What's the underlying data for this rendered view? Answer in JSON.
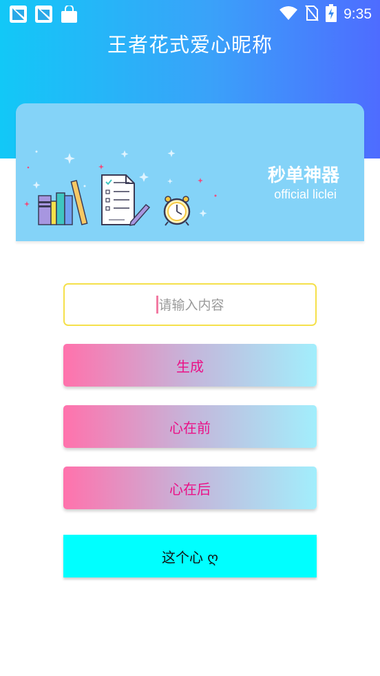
{
  "status_bar": {
    "time": "9:35"
  },
  "app": {
    "title": "王者花式爱心昵称"
  },
  "banner": {
    "title": "秒单神器",
    "subtitle": "official liclei"
  },
  "input": {
    "placeholder": "请输入内容",
    "value": ""
  },
  "buttons": {
    "generate": "生成",
    "heart_front": "心在前",
    "heart_back": "心在后",
    "this_heart": "这个心 ღ"
  },
  "colors": {
    "header_gradient": [
      "#12c8f7",
      "#4e6cff"
    ],
    "banner_bg": "#84d3f8",
    "button_text": "#ea1187",
    "cyan_button": "#00ffff",
    "input_border": "#f5e04a"
  },
  "icons": [
    "picture-notification-icon",
    "picture-notification-icon",
    "shopping-bag-icon",
    "wifi-icon",
    "no-sim-icon",
    "battery-charging-icon",
    "books-icon",
    "checklist-icon",
    "pencil-icon",
    "alarm-clock-icon"
  ]
}
